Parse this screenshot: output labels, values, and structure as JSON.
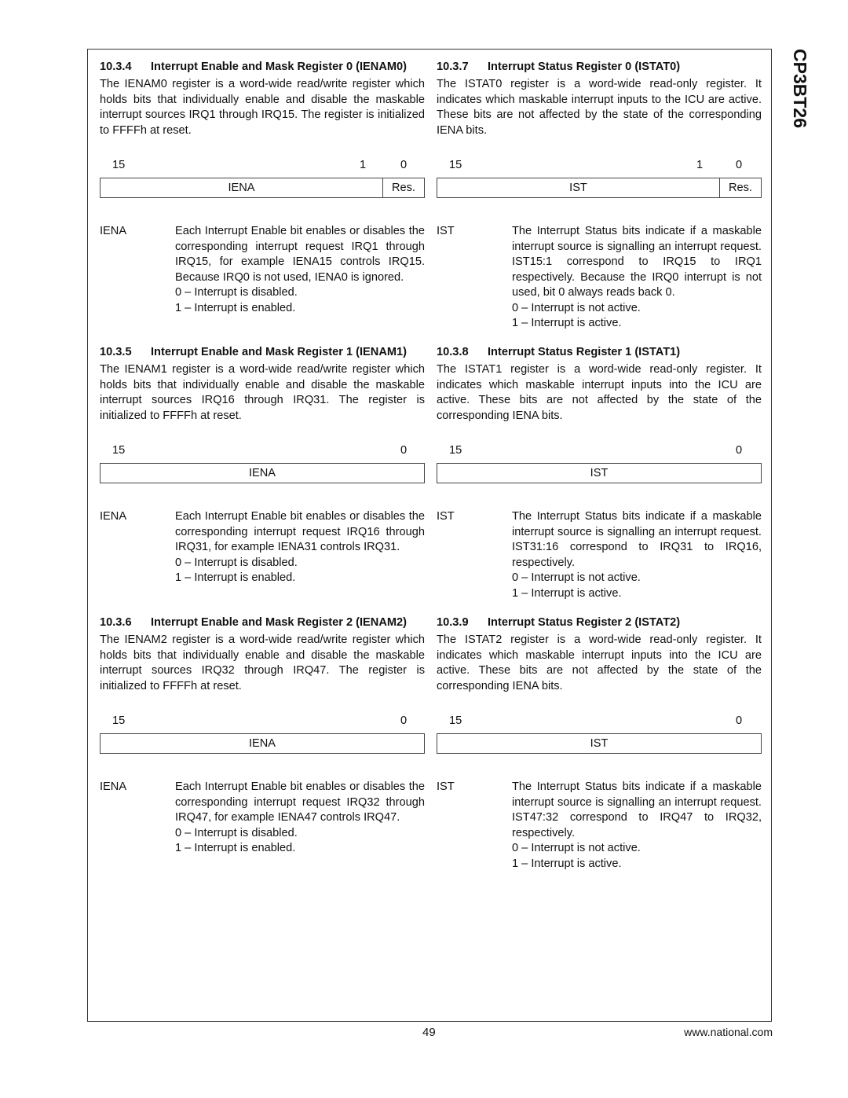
{
  "document": {
    "side_title": "CP3BT26",
    "page_number": "49",
    "website": "www.national.com"
  },
  "left_column": [
    {
      "number": "10.3.4",
      "title": "Interrupt Enable and Mask Register 0 (IENAM0)",
      "paragraph": "The IENAM0 register is a word-wide read/write register which holds bits that individually enable and disable the maskable interrupt sources IRQ1 through IRQ15. The register is initialized to FFFFh at reset.",
      "register": {
        "bit_labels": [
          "15",
          "1",
          "0"
        ],
        "fields": [
          "IENA",
          "Res."
        ]
      },
      "field_desc": {
        "name": "IENA",
        "text": "Each Interrupt Enable bit enables or disables the corresponding interrupt request IRQ1 through IRQ15, for example IENA15 controls IRQ15. Because IRQ0 is not used, IENA0 is ignored.",
        "options": [
          "0 – Interrupt is disabled.",
          "1 – Interrupt is enabled."
        ]
      }
    },
    {
      "number": "10.3.5",
      "title": "Interrupt Enable and Mask Register 1 (IENAM1)",
      "paragraph": "The IENAM1 register is a word-wide read/write register which holds bits that individually enable and disable the maskable interrupt sources IRQ16 through IRQ31. The register is initialized to FFFFh at reset.",
      "register": {
        "bit_labels": [
          "15",
          "0"
        ],
        "fields": [
          "IENA"
        ]
      },
      "field_desc": {
        "name": "IENA",
        "text": "Each Interrupt Enable bit enables or disables the corresponding interrupt request IRQ16 through IRQ31, for example IENA31 controls IRQ31.",
        "options": [
          "0 – Interrupt is disabled.",
          "1 – Interrupt is enabled."
        ]
      }
    },
    {
      "number": "10.3.6",
      "title": "Interrupt Enable and Mask Register 2 (IENAM2)",
      "paragraph": "The IENAM2 register is a word-wide read/write register which holds bits that individually enable and disable the maskable interrupt sources IRQ32 through IRQ47. The register is initialized to FFFFh at reset.",
      "register": {
        "bit_labels": [
          "15",
          "0"
        ],
        "fields": [
          "IENA"
        ]
      },
      "field_desc": {
        "name": "IENA",
        "text": "Each Interrupt Enable bit enables or disables the corresponding interrupt request IRQ32 through IRQ47, for example IENA47 controls IRQ47.",
        "options": [
          "0 – Interrupt is disabled.",
          "1 – Interrupt is enabled."
        ]
      }
    }
  ],
  "right_column": [
    {
      "number": "10.3.7",
      "title": "Interrupt Status Register 0 (ISTAT0)",
      "paragraph": "The ISTAT0 register is a word-wide read-only register. It indicates which maskable interrupt inputs to the ICU are active. These bits are not affected by the state of the corresponding IENA bits.",
      "register": {
        "bit_labels": [
          "15",
          "1",
          "0"
        ],
        "fields": [
          "IST",
          "Res."
        ]
      },
      "field_desc": {
        "name": "IST",
        "text": "The Interrupt Status bits indicate if a maskable interrupt source is signalling an interrupt request. IST15:1 correspond to IRQ15 to IRQ1 respectively. Because the IRQ0 interrupt is not used, bit 0 always reads back 0.",
        "options": [
          "0 – Interrupt is not active.",
          "1 – Interrupt is active."
        ]
      }
    },
    {
      "number": "10.3.8",
      "title": "Interrupt Status Register 1 (ISTAT1)",
      "paragraph": "The ISTAT1 register is a word-wide read-only register. It indicates which maskable interrupt inputs into the ICU are active. These bits are not affected by the state of the corresponding IENA bits.",
      "register": {
        "bit_labels": [
          "15",
          "0"
        ],
        "fields": [
          "IST"
        ]
      },
      "field_desc": {
        "name": "IST",
        "text": "The Interrupt Status bits indicate if a maskable interrupt source is signalling an interrupt request. IST31:16 correspond to IRQ31 to IRQ16, respectively.",
        "options": [
          "0 – Interrupt is not active.",
          "1 – Interrupt is active."
        ]
      }
    },
    {
      "number": "10.3.9",
      "title": "Interrupt Status Register 2 (ISTAT2)",
      "paragraph": "The ISTAT2 register is a word-wide read-only register. It indicates which maskable interrupt inputs into the ICU are active. These bits are not affected by the state of the corresponding IENA bits.",
      "register": {
        "bit_labels": [
          "15",
          "0"
        ],
        "fields": [
          "IST"
        ]
      },
      "field_desc": {
        "name": "IST",
        "text": "The Interrupt Status bits indicate if a maskable interrupt source is signalling an interrupt request. IST47:32 correspond to IRQ47 to IRQ32, respectively.",
        "options": [
          "0 – Interrupt is not active.",
          "1 – Interrupt is active."
        ]
      }
    }
  ]
}
